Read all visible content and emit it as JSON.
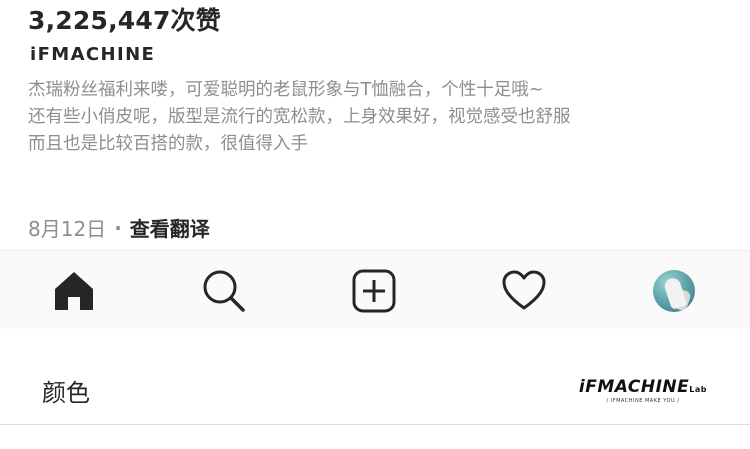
{
  "post": {
    "likes": "3,225,447次赞",
    "username": "iFMACHINE",
    "caption_lines": [
      "杰瑞粉丝福利来喽，可爱聪明的老鼠形象与T恤融合，个性十足哦~",
      "还有些小俏皮呢，版型是流行的宽松款，上身效果好，视觉感受也舒服",
      "而且也是比较百搭的款，很值得入手"
    ],
    "date": "8月12日",
    "dot": "·",
    "translate_label": "查看翻译"
  },
  "tabbar": {
    "items": [
      "home-icon",
      "search-icon",
      "new-post-icon",
      "heart-icon",
      "profile-avatar"
    ]
  },
  "section": {
    "color_label": "颜色",
    "brand_name": "iFMACHINE",
    "brand_suffix": "Lab",
    "brand_tagline": "/ IFMACHINE MAKE YOU /"
  },
  "colors": {
    "text_primary": "#262626",
    "text_secondary": "#8e8e8e",
    "tabbar_bg": "#fafafa"
  }
}
